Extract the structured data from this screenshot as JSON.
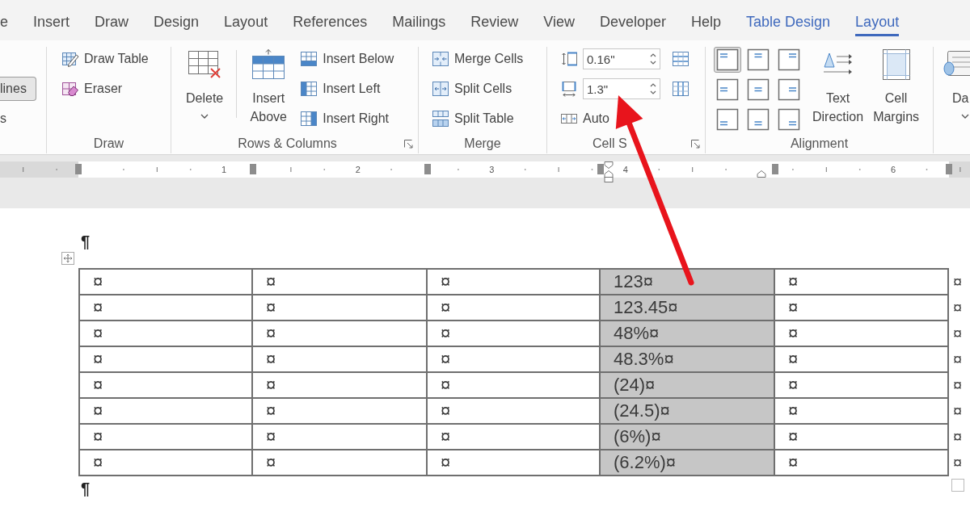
{
  "tabs": [
    {
      "label": "e",
      "contextual": false,
      "selected": false
    },
    {
      "label": "Insert",
      "contextual": false,
      "selected": false
    },
    {
      "label": "Draw",
      "contextual": false,
      "selected": false
    },
    {
      "label": "Design",
      "contextual": false,
      "selected": false
    },
    {
      "label": "Layout",
      "contextual": false,
      "selected": false
    },
    {
      "label": "References",
      "contextual": false,
      "selected": false
    },
    {
      "label": "Mailings",
      "contextual": false,
      "selected": false
    },
    {
      "label": "Review",
      "contextual": false,
      "selected": false
    },
    {
      "label": "View",
      "contextual": false,
      "selected": false
    },
    {
      "label": "Developer",
      "contextual": false,
      "selected": false
    },
    {
      "label": "Help",
      "contextual": false,
      "selected": false
    },
    {
      "label": "Table Design",
      "contextual": true,
      "selected": false
    },
    {
      "label": "Layout",
      "contextual": true,
      "selected": true
    }
  ],
  "ribbon": {
    "groups": [
      {
        "controls": [
          {
            "kind": "toggle",
            "label": "lines",
            "on": true
          },
          {
            "kind": "text",
            "label": "s"
          }
        ]
      },
      {
        "label": "Draw",
        "controls": [
          {
            "kind": "small",
            "label": "Draw Table"
          },
          {
            "kind": "small",
            "label": "Eraser"
          }
        ]
      },
      {
        "label": "Rows & Columns",
        "launcher": true,
        "controls": [
          {
            "kind": "large",
            "label": "Delete",
            "menu": true
          },
          {
            "kind": "large",
            "label": "Insert Above",
            "menu": false
          },
          {
            "kind": "small",
            "label": "Insert Below"
          },
          {
            "kind": "small",
            "label": "Insert Left"
          },
          {
            "kind": "small",
            "label": "Insert Right"
          }
        ]
      },
      {
        "label": "Merge",
        "controls": [
          {
            "kind": "small",
            "label": "Merge Cells"
          },
          {
            "kind": "small",
            "label": "Split Cells"
          },
          {
            "kind": "small",
            "label": "Split Table"
          }
        ]
      },
      {
        "label": "Cell S",
        "launcher": true,
        "controls": [
          {
            "kind": "spin",
            "value": "0.16\""
          },
          {
            "kind": "spin",
            "value": "1.3\""
          },
          {
            "kind": "small",
            "label": "Auto"
          }
        ]
      },
      {
        "label": "Alignment",
        "controls": [
          {
            "kind": "align-grid",
            "options": [
              {
                "selected": true
              },
              {
                "selected": false
              },
              {
                "selected": false
              },
              {
                "selected": false
              },
              {
                "selected": false
              },
              {
                "selected": false
              },
              {
                "selected": false
              },
              {
                "selected": false
              },
              {
                "selected": false
              }
            ]
          },
          {
            "kind": "large",
            "label": "Text Direction",
            "menu": false
          },
          {
            "kind": "large",
            "label": "Cell Margins",
            "menu": false
          }
        ]
      },
      {
        "controls": [
          {
            "kind": "large",
            "label": "Da",
            "menu": true
          }
        ]
      }
    ]
  },
  "ruler": {
    "numbers": [
      "1",
      "2",
      "3",
      "4",
      "6"
    ]
  },
  "document": {
    "mark_above": "¶",
    "table": {
      "columns": [
        {
          "selected": false
        },
        {
          "selected": false
        },
        {
          "selected": false
        },
        {
          "selected": true
        },
        {
          "selected": false
        }
      ],
      "rows": [
        {
          "cells": [
            "¤",
            "¤",
            "¤",
            "123¤",
            "¤"
          ],
          "end_mark": "¤"
        },
        {
          "cells": [
            "¤",
            "¤",
            "¤",
            "123.45¤",
            "¤"
          ],
          "end_mark": "¤"
        },
        {
          "cells": [
            "¤",
            "¤",
            "¤",
            "48%¤",
            "¤"
          ],
          "end_mark": "¤"
        },
        {
          "cells": [
            "¤",
            "¤",
            "¤",
            "48.3%¤",
            "¤"
          ],
          "end_mark": "¤"
        },
        {
          "cells": [
            "¤",
            "¤",
            "¤",
            "(24)¤",
            "¤"
          ],
          "end_mark": "¤"
        },
        {
          "cells": [
            "¤",
            "¤",
            "¤",
            "(24.5)¤",
            "¤"
          ],
          "end_mark": "¤"
        },
        {
          "cells": [
            "¤",
            "¤",
            "¤",
            "(6%)¤",
            "¤"
          ],
          "end_mark": "¤"
        },
        {
          "cells": [
            "¤",
            "¤",
            "¤",
            "(6.2%)¤",
            "¤"
          ],
          "end_mark": "¤"
        }
      ]
    },
    "mark_below": "¶"
  },
  "callout": {
    "kind": "arrow"
  }
}
